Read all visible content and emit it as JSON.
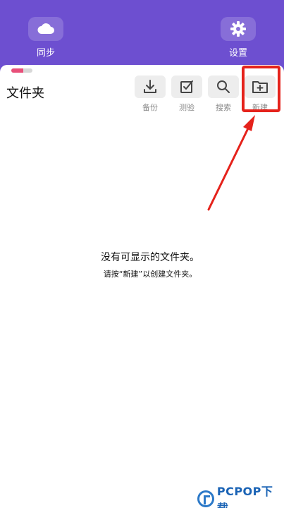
{
  "header": {
    "sync_label": "同步",
    "settings_label": "设置"
  },
  "panel": {
    "title": "文件夹",
    "toolbar": {
      "backup_label": "备份",
      "test_label": "测验",
      "search_label": "搜索",
      "new_label": "新建"
    },
    "empty_state": {
      "line1": "没有可显示的文件夹。",
      "line2": "请按“新建”以创建文件夹。"
    }
  },
  "watermark": {
    "text": "PCPOP下载"
  },
  "colors": {
    "header_bg": "#6d4fd0",
    "highlight": "#e5221b",
    "tool_bg": "#ededed",
    "tag_accent": "#e84f79"
  },
  "icons": {
    "sync": "cloud-icon",
    "settings": "gear-icon",
    "backup": "download-icon",
    "test": "checkbox-icon",
    "search": "search-icon",
    "new": "folder-plus-icon"
  }
}
